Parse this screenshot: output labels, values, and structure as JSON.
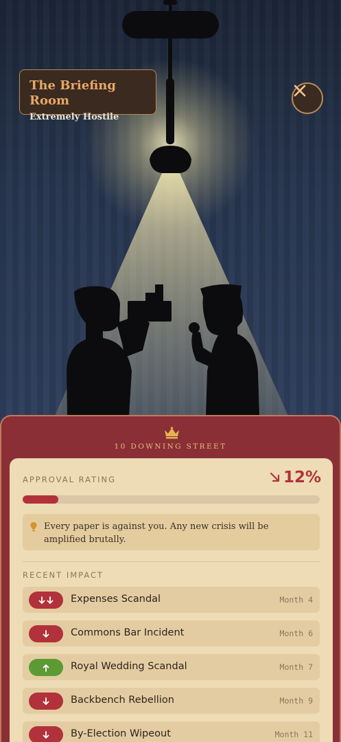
{
  "location": {
    "title": "The Briefing Room",
    "subtitle": "Extremely Hostile"
  },
  "controls": {
    "close_icon": "close-icon"
  },
  "panel": {
    "heading": "10 DOWNING STREET",
    "icon": "crown-icon"
  },
  "approval": {
    "label": "APPROVAL RATING",
    "value": "12%",
    "percent": 12,
    "trend": "down",
    "notice": "Every paper is against you. Any new crisis will be amplified brutally."
  },
  "recent": {
    "label": "RECENT IMPACT",
    "items": [
      {
        "name": "Expenses Scandal",
        "month": "Month 4",
        "trend": "double-down"
      },
      {
        "name": "Commons Bar Incident",
        "month": "Month 6",
        "trend": "down"
      },
      {
        "name": "Royal Wedding Scandal",
        "month": "Month 7",
        "trend": "up"
      },
      {
        "name": "Backbench Rebellion",
        "month": "Month 9",
        "trend": "down"
      },
      {
        "name": "By-Election Wipeout",
        "month": "Month 11",
        "trend": "down"
      }
    ]
  },
  "colors": {
    "panel": "#8a2f35",
    "card": "#eedcb6",
    "negative": "#b1323a",
    "positive": "#5c9b34",
    "accent": "#e8a868"
  }
}
